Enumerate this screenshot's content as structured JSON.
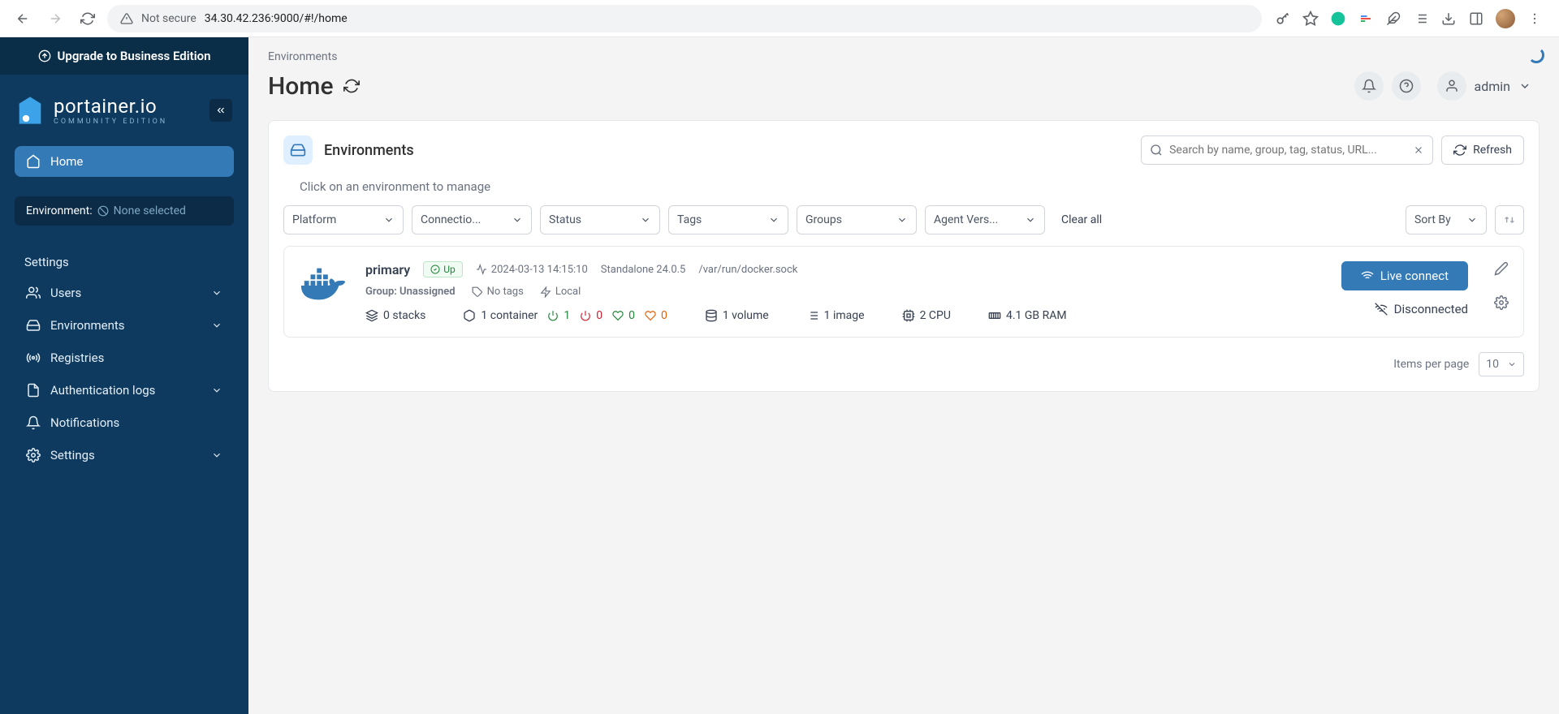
{
  "browser": {
    "not_secure": "Not secure",
    "url": "34.30.42.236:9000/#!/home"
  },
  "sidebar": {
    "upgrade": "Upgrade to Business Edition",
    "logo": "portainer.io",
    "logo_sub": "COMMUNITY EDITION",
    "home": "Home",
    "environment_label": "Environment:",
    "environment_value": "None selected",
    "settings_section": "Settings",
    "items": [
      {
        "label": "Users"
      },
      {
        "label": "Environments"
      },
      {
        "label": "Registries"
      },
      {
        "label": "Authentication logs"
      },
      {
        "label": "Notifications"
      },
      {
        "label": "Settings"
      }
    ]
  },
  "header": {
    "breadcrumb": "Environments",
    "title": "Home",
    "user": "admin"
  },
  "card": {
    "title": "Environments",
    "search_placeholder": "Search by name, group, tag, status, URL...",
    "refresh": "Refresh",
    "hint": "Click on an environment to manage",
    "filters": {
      "platform": "Platform",
      "connection": "Connectio...",
      "status": "Status",
      "tags": "Tags",
      "groups": "Groups",
      "agent": "Agent Vers..."
    },
    "clear_all": "Clear all",
    "sort_by": "Sort By",
    "items_per_page": "Items per page",
    "items_value": "10"
  },
  "env": {
    "name": "primary",
    "status": "Up",
    "timestamp": "2024-03-13 14:15:10",
    "type": "Standalone 24.0.5",
    "socket": "/var/run/docker.sock",
    "group": "Group: Unassigned",
    "tags": "No tags",
    "location": "Local",
    "stacks": "0 stacks",
    "containers": "1 container",
    "running": "1",
    "stopped": "0",
    "healthy": "0",
    "unhealthy": "0",
    "volumes": "1 volume",
    "images": "1 image",
    "cpu": "2 CPU",
    "ram": "4.1 GB RAM",
    "connect": "Live connect",
    "disconnected": "Disconnected"
  }
}
